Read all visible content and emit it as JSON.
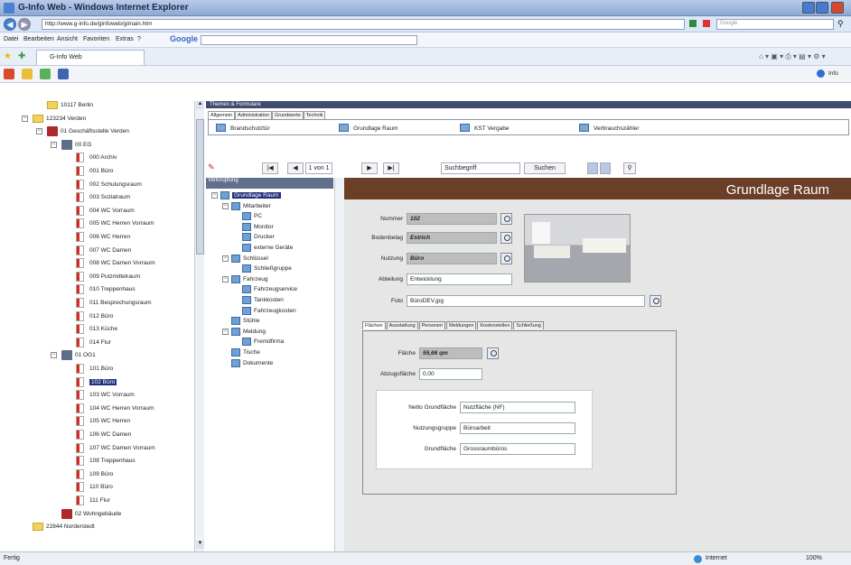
{
  "window": {
    "title": "G-Info Web - Windows Internet Explorer"
  },
  "address": {
    "url": "http://www.g-info.de/ginfoweb/gimain.htm",
    "search_placeholder": "Google"
  },
  "menu": [
    "Datei",
    "Bearbeiten",
    "Ansicht",
    "Favoriten",
    "Extras",
    "?"
  ],
  "google_bar_label": "Google",
  "browser_tab": "G-Info Web",
  "info_label": "Info",
  "tree": {
    "items": [
      {
        "label": "10117 Berlin",
        "level": 2,
        "kind": "folder"
      },
      {
        "label": "123234 Verden",
        "level": 1,
        "kind": "folder",
        "exp": "−"
      },
      {
        "label": "01 Geschäftsstelle Verden",
        "level": 2,
        "kind": "bldg-red",
        "exp": "−"
      },
      {
        "label": "00 EG",
        "level": 3,
        "kind": "bldg",
        "exp": "−"
      },
      {
        "label": "000 Archiv",
        "level": 4,
        "kind": "room"
      },
      {
        "label": "001 Büro",
        "level": 4,
        "kind": "room"
      },
      {
        "label": "002 Schulungsraum",
        "level": 4,
        "kind": "room"
      },
      {
        "label": "003 Sozialraum",
        "level": 4,
        "kind": "room"
      },
      {
        "label": "004 WC Vorraum",
        "level": 4,
        "kind": "room"
      },
      {
        "label": "005 WC Herren Vorraum",
        "level": 4,
        "kind": "room"
      },
      {
        "label": "006 WC Herren",
        "level": 4,
        "kind": "room"
      },
      {
        "label": "007 WC Damen",
        "level": 4,
        "kind": "room"
      },
      {
        "label": "008 WC Damen Vorraum",
        "level": 4,
        "kind": "room"
      },
      {
        "label": "009 Putzmittelraum",
        "level": 4,
        "kind": "room"
      },
      {
        "label": "010 Treppenhaus",
        "level": 4,
        "kind": "room"
      },
      {
        "label": "011 Besprechungsraum",
        "level": 4,
        "kind": "room"
      },
      {
        "label": "012 Büro",
        "level": 4,
        "kind": "room"
      },
      {
        "label": "013 Küche",
        "level": 4,
        "kind": "room"
      },
      {
        "label": "014 Flur",
        "level": 4,
        "kind": "room"
      },
      {
        "label": "01 OG1",
        "level": 3,
        "kind": "bldg",
        "exp": "−"
      },
      {
        "label": "101 Büro",
        "level": 4,
        "kind": "room"
      },
      {
        "label": "102 Büro",
        "level": 4,
        "kind": "room",
        "selected": true
      },
      {
        "label": "103 WC Vorraum",
        "level": 4,
        "kind": "room"
      },
      {
        "label": "104 WC Herren Vorraum",
        "level": 4,
        "kind": "room"
      },
      {
        "label": "105 WC Herren",
        "level": 4,
        "kind": "room"
      },
      {
        "label": "106 WC Damen",
        "level": 4,
        "kind": "room"
      },
      {
        "label": "107 WC Damen Vorraum",
        "level": 4,
        "kind": "room"
      },
      {
        "label": "108 Treppenhaus",
        "level": 4,
        "kind": "room"
      },
      {
        "label": "109 Büro",
        "level": 4,
        "kind": "room"
      },
      {
        "label": "110 Büro",
        "level": 4,
        "kind": "room"
      },
      {
        "label": "111 Flur",
        "level": 4,
        "kind": "room"
      },
      {
        "label": "02 Wohngebäude",
        "level": 3,
        "kind": "bldg-red"
      },
      {
        "label": "22844 Norderstedt",
        "level": 1,
        "kind": "folder"
      }
    ]
  },
  "themen": {
    "header": "Themen & Formulare",
    "tabs": [
      "Allgemein",
      "Administration",
      "Grundwerte",
      "Technik"
    ],
    "forms": [
      "Brandschutztür",
      "Grundlage Raum",
      "KST Vergabe",
      "Verbrauchszähler"
    ]
  },
  "record_nav": {
    "first": "|◀",
    "prev": "◀",
    "position": "1 von 1",
    "next": "▶",
    "last": "▶|",
    "search_placeholder": "Suchbegriff",
    "search_button": "Suchen"
  },
  "objtree": {
    "header": "Verknüpfung",
    "items": [
      {
        "label": "Grundlage Raum",
        "level": 0,
        "exp": "−",
        "selected": true
      },
      {
        "label": "Mitarbeiter",
        "level": 1,
        "exp": "−"
      },
      {
        "label": "PC",
        "level": 2
      },
      {
        "label": "Monitor",
        "level": 2
      },
      {
        "label": "Drucker",
        "level": 2
      },
      {
        "label": "externe Geräte",
        "level": 2
      },
      {
        "label": "Schlüssel",
        "level": 1,
        "exp": "−"
      },
      {
        "label": "Schließgruppe",
        "level": 2
      },
      {
        "label": "Fahrzeug",
        "level": 1,
        "exp": "−"
      },
      {
        "label": "Fahrzeugservice",
        "level": 2
      },
      {
        "label": "Tankkosten",
        "level": 2
      },
      {
        "label": "Fahrzeugkosten",
        "level": 2
      },
      {
        "label": "Stühle",
        "level": 1
      },
      {
        "label": "Meldung",
        "level": 1,
        "exp": "−"
      },
      {
        "label": "Fremdfirma",
        "level": 2
      },
      {
        "label": "Tische",
        "level": 1
      },
      {
        "label": "Dokumente",
        "level": 1
      }
    ]
  },
  "form": {
    "title": "Grundlage Raum",
    "nummer_label": "Nummer",
    "nummer_value": "102",
    "bodenbelag_label": "Bodenbelag",
    "bodenbelag_value": "Estrich",
    "nutzung_label": "Nutzung",
    "nutzung_value": "Büro",
    "abteilung_label": "Abteilung",
    "abteilung_value": "Entwicklung",
    "foto_label": "Foto",
    "foto_value": "BüroDEV.jpg",
    "tabs": [
      "Flächen",
      "Ausstattung",
      "Personen",
      "Meldungen",
      "Kostenstellen",
      "Schließung"
    ],
    "flaeche_label": "Fläche",
    "flaeche_value": "55,66 qm",
    "abzug_label": "Abzugsfläche",
    "abzug_value": "0,00",
    "netto_label": "Netto Grundfläche",
    "netto_value": "Nutzfläche (NF)",
    "nutzgruppe_label": "Nutzungsgruppe",
    "nutzgruppe_value": "Büroarbeit",
    "grundflaeche_label": "Grundfläche",
    "grundflaeche_value": "Grossraumbüros"
  },
  "status": {
    "left": "Fertig",
    "zone": "Internet",
    "zoom": "100%"
  }
}
